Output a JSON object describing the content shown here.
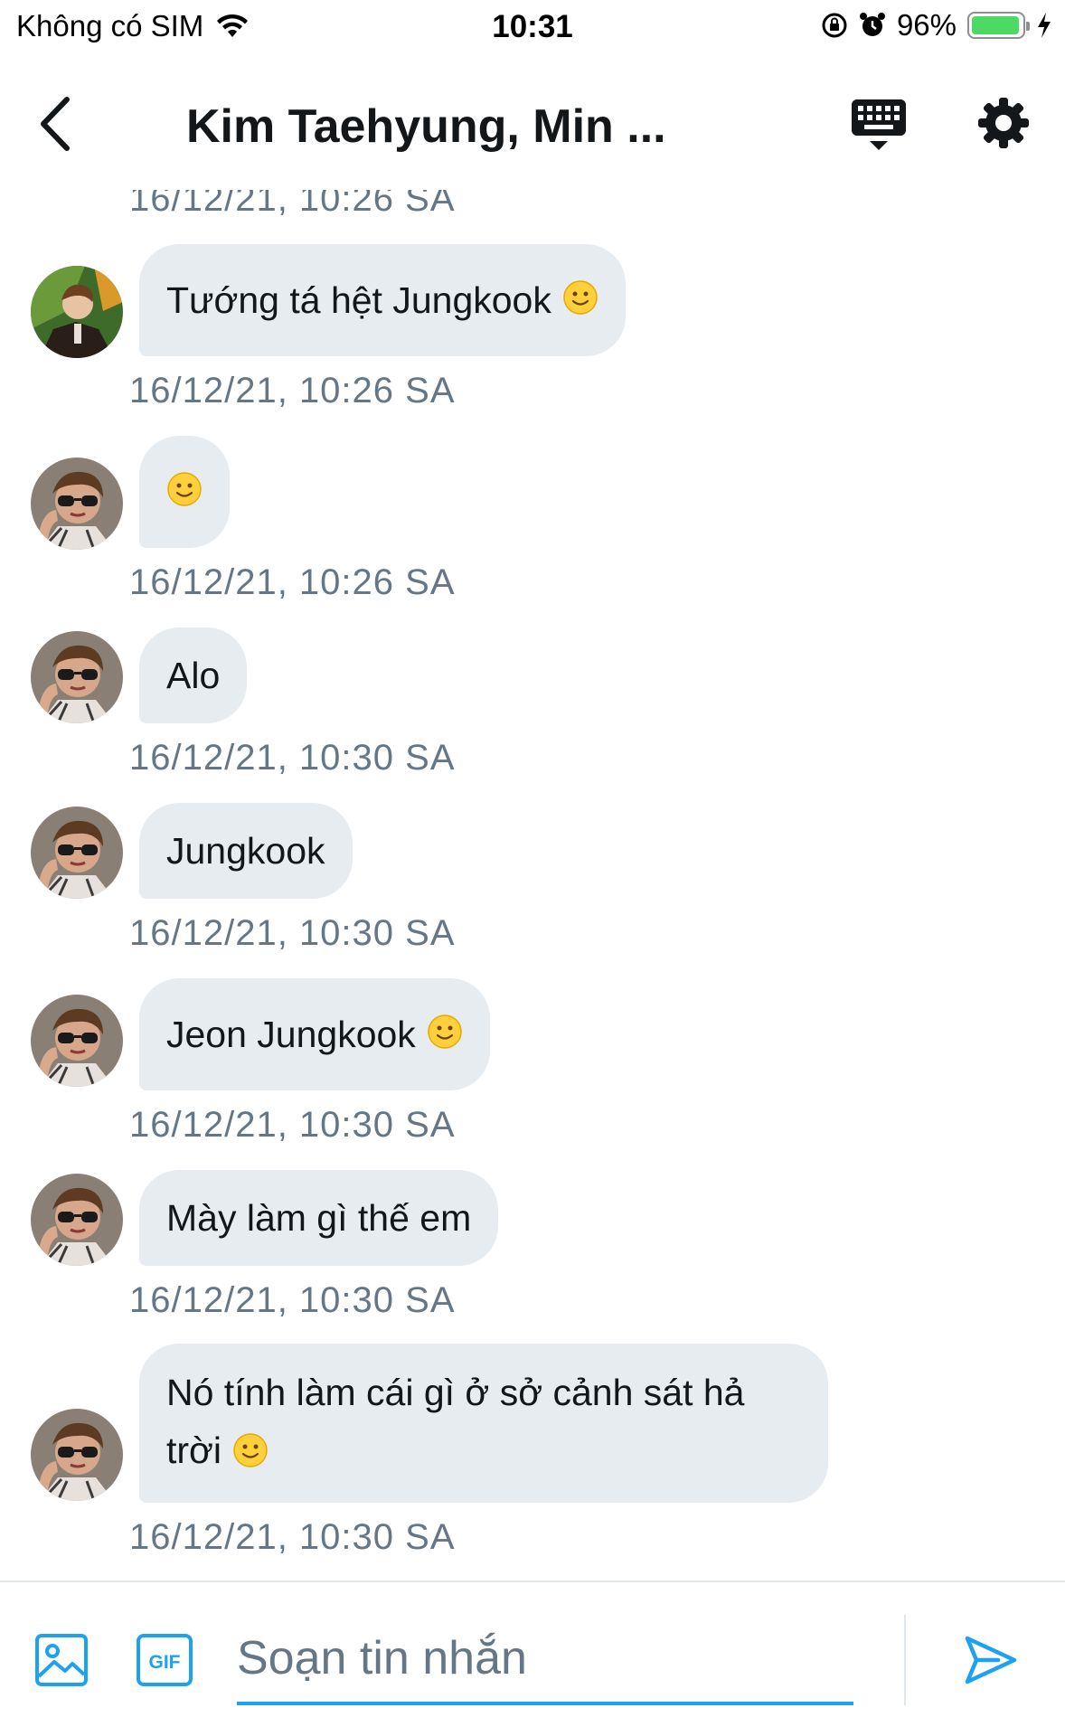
{
  "status_bar": {
    "carrier": "Không có SIM",
    "time": "10:31",
    "battery_percent": "96%",
    "battery_level": 0.96,
    "battery_color": "#4cd964",
    "icons": [
      "wifi-icon",
      "orientation-lock-icon",
      "alarm-icon",
      "battery-icon",
      "charging-bolt-icon"
    ]
  },
  "header": {
    "title": "Kim Taehyung, Min ...",
    "icons": [
      "back-chevron-icon",
      "keyboard-icon",
      "gear-icon"
    ]
  },
  "messages": {
    "partial_timestamp": "16/12/21, 10:26 SA",
    "items": [
      {
        "text": "Tướng tá hệt Jungkook",
        "emoji": "slightly-smiling-face",
        "timestamp": "16/12/21, 10:26 SA"
      },
      {
        "text": "",
        "emoji": "slightly-smiling-face",
        "timestamp": "16/12/21, 10:26 SA"
      },
      {
        "text": "Alo",
        "emoji": "",
        "timestamp": "16/12/21, 10:30 SA"
      },
      {
        "text": "Jungkook",
        "emoji": "",
        "timestamp": "16/12/21, 10:30 SA"
      },
      {
        "text": "Jeon Jungkook",
        "emoji": "slightly-smiling-face",
        "timestamp": "16/12/21, 10:30 SA"
      },
      {
        "text": "Mày làm gì thế em",
        "emoji": "",
        "timestamp": "16/12/21, 10:30 SA"
      },
      {
        "line1": "Nó tính làm cái gì ở sở cảnh sát hả",
        "line2": "trời",
        "emoji": "slightly-smiling-face",
        "timestamp": "16/12/21, 10:30 SA"
      }
    ]
  },
  "compose": {
    "placeholder": "Soạn tin nhắn",
    "gif_label": "GIF",
    "accent_color": "#1da1f2",
    "icons": [
      "image-icon",
      "gif-icon",
      "send-icon"
    ]
  },
  "colors": {
    "bubble_bg": "#e6ecf0",
    "timestamp_text": "#657786",
    "primary_text": "#14171a"
  }
}
